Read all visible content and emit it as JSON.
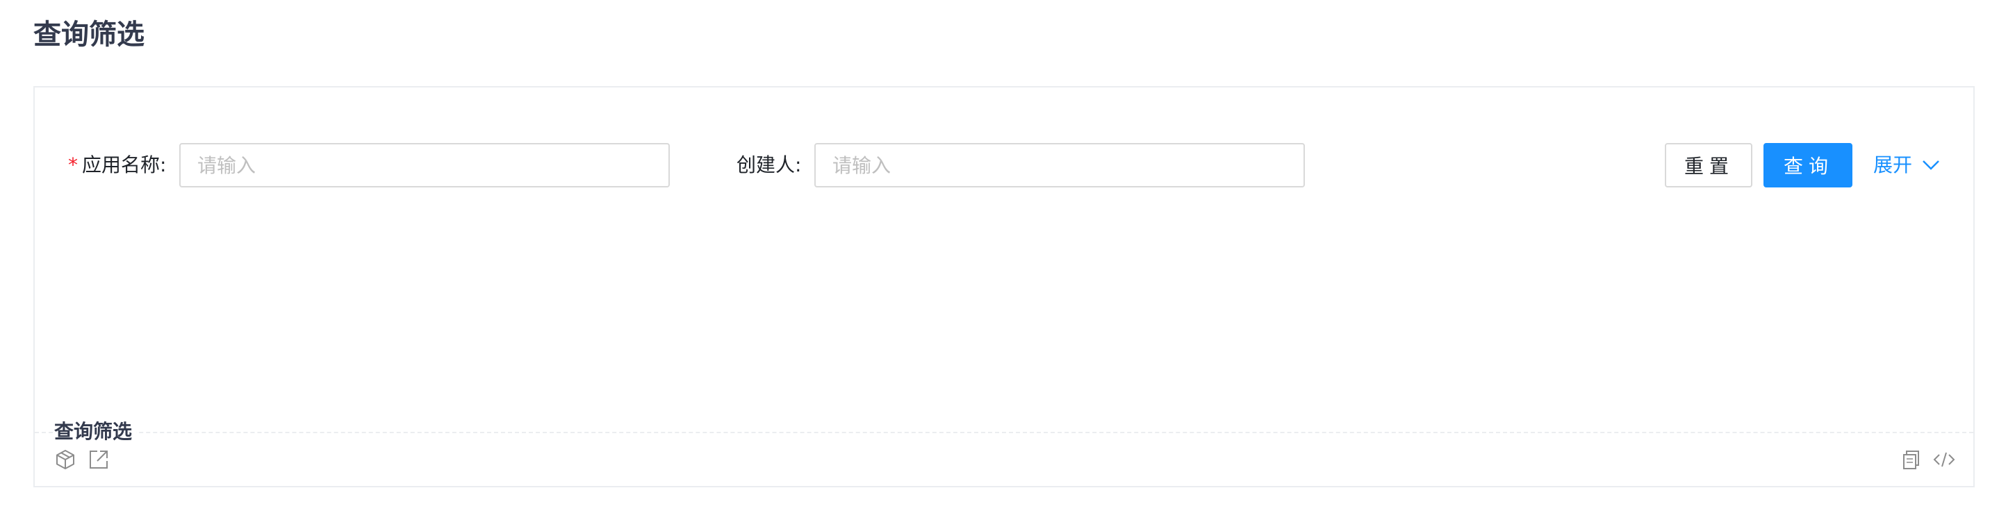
{
  "page": {
    "title": "查询筛选"
  },
  "form": {
    "app_name": {
      "required_mark": "*",
      "label": "应用名称:",
      "value": "",
      "placeholder": "请输入"
    },
    "creator": {
      "label": "创建人:",
      "value": "",
      "placeholder": "请输入"
    },
    "reset_label": "重置",
    "query_label": "查询",
    "expand_label": "展开",
    "expand_icon": "chevron-down-icon"
  },
  "demo_meta": {
    "title": "查询筛选",
    "icons": [
      "codesandbox-icon",
      "open-external-icon",
      "copy-icon",
      "code-icon"
    ]
  },
  "colors": {
    "primary": "#1890ff",
    "required": "#f5222d",
    "title": "#333a4d",
    "placeholder": "#bfbfbf",
    "border": "#d9d9d9"
  }
}
